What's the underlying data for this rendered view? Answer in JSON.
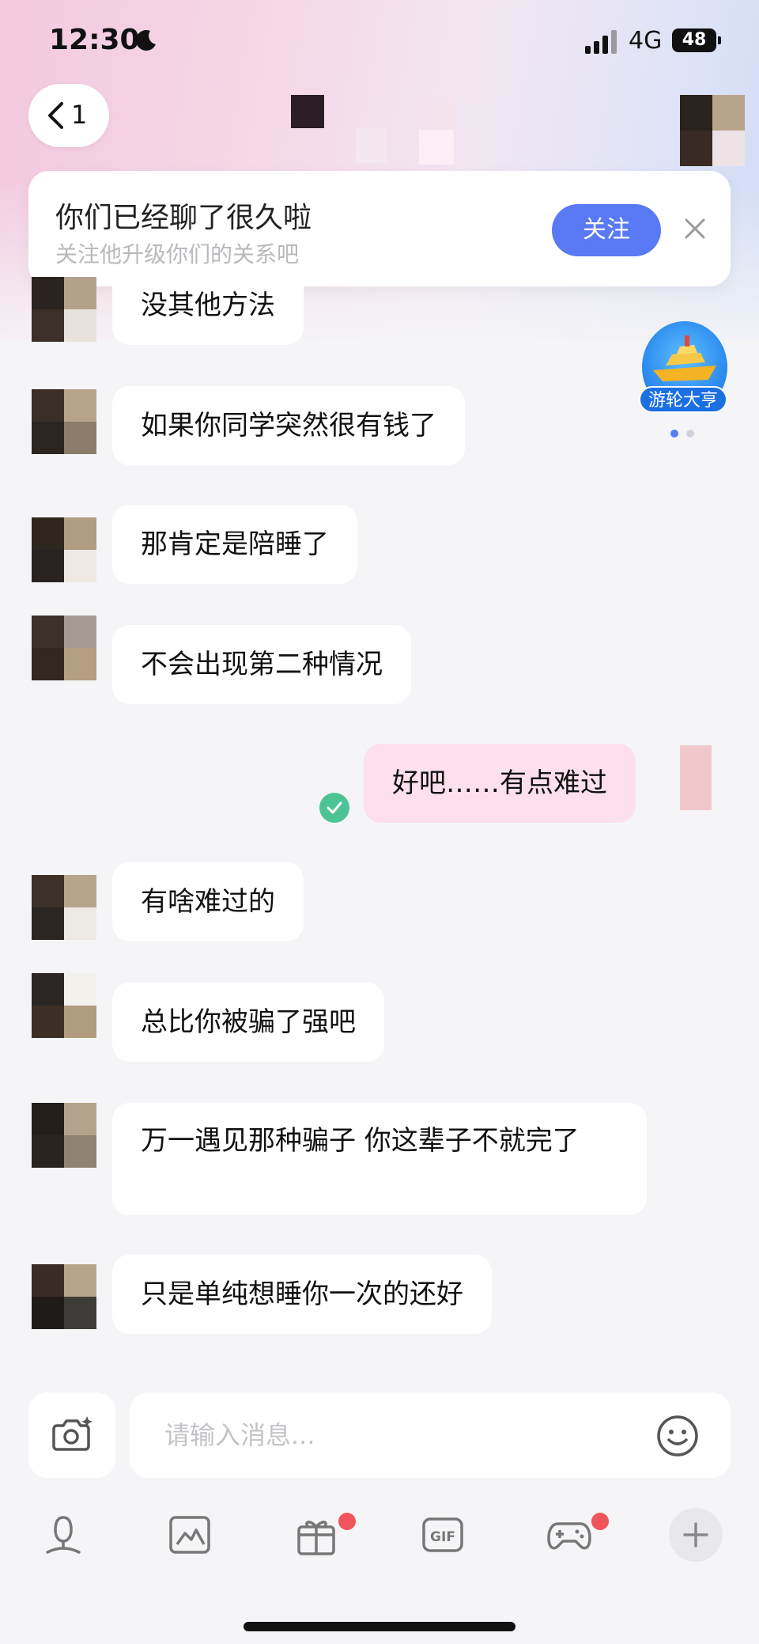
{
  "status_bar": {
    "time": "12:30",
    "network": "4G",
    "battery": "48"
  },
  "nav": {
    "back_count": "1"
  },
  "banner": {
    "title": "你们已经聊了很久啦",
    "subtitle": "关注他升级你们的关系吧",
    "follow_label": "关注"
  },
  "widget": {
    "label": "游轮大亨"
  },
  "messages": [
    {
      "side": "in",
      "text": "没其他方法"
    },
    {
      "side": "in",
      "text": "如果你同学突然很有钱了"
    },
    {
      "side": "in",
      "text": "那肯定是陪睡了"
    },
    {
      "side": "in",
      "text": "不会出现第二种情况"
    },
    {
      "side": "out",
      "text": "好吧……有点难过"
    },
    {
      "side": "in",
      "text": "有啥难过的"
    },
    {
      "side": "in",
      "text": "总比你被骗了强吧"
    },
    {
      "side": "in",
      "text": "万一遇见那种骗子  你这辈子不就完了"
    },
    {
      "side": "in",
      "text": "只是单纯想睡你一次的还好"
    }
  ],
  "composer": {
    "placeholder": "请输入消息..."
  },
  "toolbar": {
    "items": [
      "voice-icon",
      "image-icon",
      "gift-icon",
      "gif-icon",
      "game-icon",
      "plus-icon"
    ],
    "gif_label": "GIF"
  },
  "colors": {
    "accent": "#5979f5",
    "outgoing_bubble": "#fde0ec",
    "badge": "#f2545b",
    "check": "#4cc394"
  }
}
